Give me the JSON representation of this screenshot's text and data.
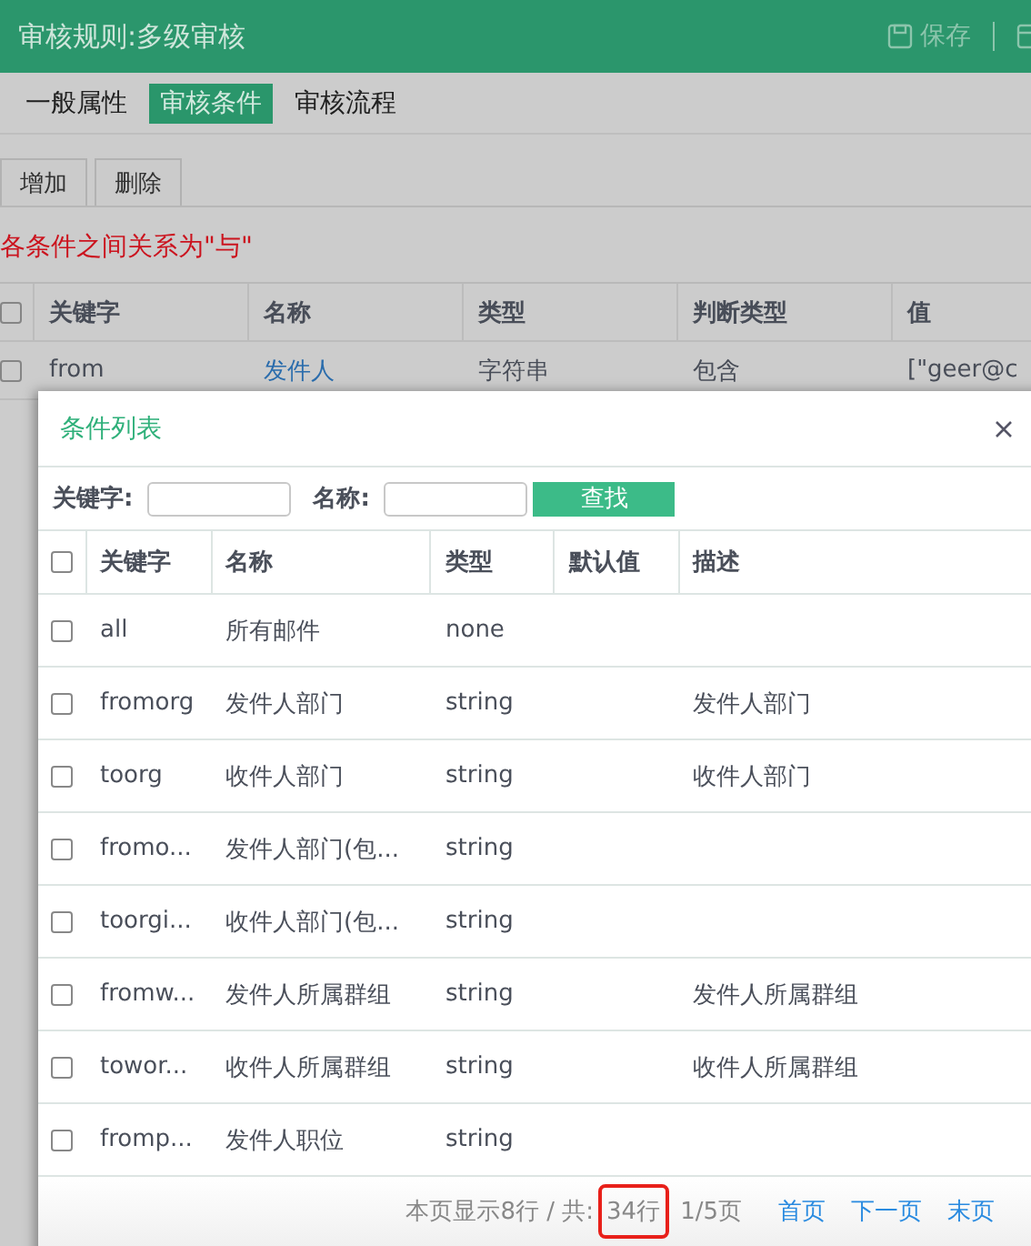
{
  "header": {
    "title": "审核规则:多级审核",
    "actions": [
      {
        "kind": "save",
        "label": "保存"
      },
      {
        "kind": "panel"
      }
    ]
  },
  "tabs": [
    {
      "label": "一般属性",
      "selected": false
    },
    {
      "label": "审核条件",
      "selected": true
    },
    {
      "label": "审核流程",
      "selected": false
    }
  ],
  "toolbar": {
    "buttons": [
      "增加",
      "删除"
    ]
  },
  "notice": "各条件之间关系为\"与\"",
  "table": {
    "all_checked": false,
    "columns": [
      "关键字",
      "名称",
      "类型",
      "判断类型",
      "值"
    ],
    "rows": [
      {
        "checked": false,
        "cells": [
          "from",
          "发件人",
          "字符串",
          "包含",
          "[\"geer@c"
        ]
      }
    ]
  },
  "dialog": {
    "title": "条件列表",
    "search": [
      {
        "label": "关键字:"
      },
      {
        "label": "名称:"
      }
    ],
    "search_button": "查找",
    "table": {
      "all_checked": false,
      "columns": [
        "关键字",
        "名称",
        "类型",
        "默认值",
        "描述"
      ],
      "rows": [
        {
          "checked": false,
          "cells": [
            "all",
            "所有邮件",
            "none",
            "",
            ""
          ]
        },
        {
          "checked": false,
          "cells": [
            "fromorg",
            "发件人部门",
            "string",
            "",
            "发件人部门"
          ]
        },
        {
          "checked": false,
          "cells": [
            "toorg",
            "收件人部门",
            "string",
            "",
            "收件人部门"
          ]
        },
        {
          "checked": false,
          "cells": [
            "fromo...",
            "发件人部门(包...",
            "string",
            "",
            ""
          ]
        },
        {
          "checked": false,
          "cells": [
            "toorgi...",
            "收件人部门(包...",
            "string",
            "",
            ""
          ]
        },
        {
          "checked": false,
          "cells": [
            "fromw...",
            "发件人所属群组",
            "string",
            "",
            "发件人所属群组"
          ]
        },
        {
          "checked": false,
          "cells": [
            "towor...",
            "收件人所属群组",
            "string",
            "",
            "收件人所属群组"
          ]
        },
        {
          "checked": false,
          "cells": [
            "fromp...",
            "发件人职位",
            "string",
            "",
            ""
          ]
        }
      ]
    },
    "footer": {
      "summary": "本页显示8行 / 共:",
      "total": {
        "text": "34行",
        "highlighted": true
      },
      "pages": "1/5页",
      "links": [
        "首页",
        "下一页",
        "末页"
      ]
    }
  }
}
